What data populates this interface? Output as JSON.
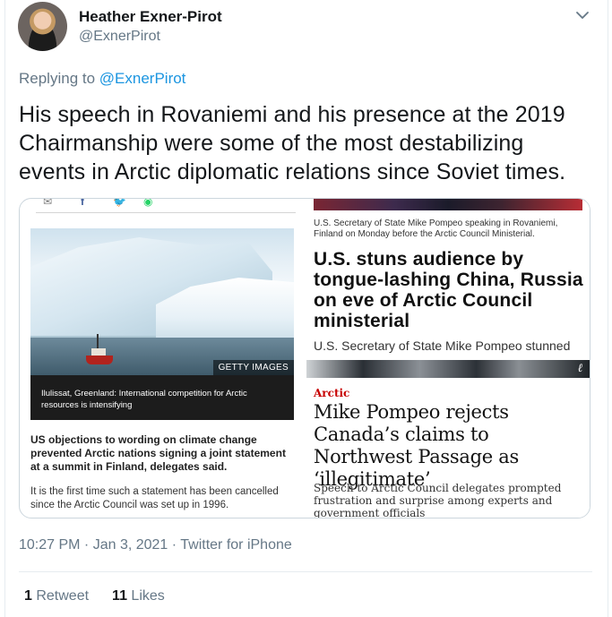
{
  "author": {
    "name": "Heather Exner-Pirot",
    "handle": "@ExnerPirot"
  },
  "reply": {
    "prefix": "Replying to ",
    "to": "@ExnerPirot"
  },
  "tweet": {
    "text": "His speech in Rovaniemi and his presence at the 2019 Chairmanship were some of the most destabilizing events in Arctic diplomatic relations since Soviet times."
  },
  "articles": {
    "left": {
      "photo_credit": "GETTY IMAGES",
      "caption": "Ilulissat, Greenland: International competition for Arctic resources is intensifying",
      "lead": "US objections to wording on climate change prevented Arctic nations signing a joint statement at a summit in Finland, delegates said.",
      "body": "It is the first time such a statement has been cancelled since the Arctic Council was set up in 1996."
    },
    "right_top": {
      "caption": "U.S. Secretary of State Mike Pompeo speaking in Rovaniemi, Finland on Monday before the Arctic Council Ministerial.",
      "headline": "U.S. stuns audience by tongue-lashing China, Russia on eve of Arctic Council ministerial",
      "summary": "U.S. Secretary of State Mike Pompeo stunned"
    },
    "right_bottom": {
      "tag": "Arctic",
      "headline": "Mike Pompeo rejects Canada’s claims to Northwest Passage as ‘illegitimate’",
      "summary": "Speech to Arctic Council delegates prompted frustration and surprise among experts and government officials"
    }
  },
  "meta": {
    "time": "10:27 PM",
    "sep1": " · ",
    "date": "Jan 3, 2021",
    "sep2": " · ",
    "source": "Twitter for iPhone"
  },
  "stats": {
    "retweets_count": "1",
    "retweets_label": " Retweet",
    "likes_count": "11",
    "likes_label": " Likes"
  },
  "colors": {
    "link": "#1b95e0",
    "muted": "#657786",
    "tag_red": "#c70000"
  },
  "icons": [
    "chevron-down-icon",
    "mail-icon",
    "facebook-icon",
    "twitter-icon",
    "whatsapp-icon",
    "expand-icon"
  ]
}
